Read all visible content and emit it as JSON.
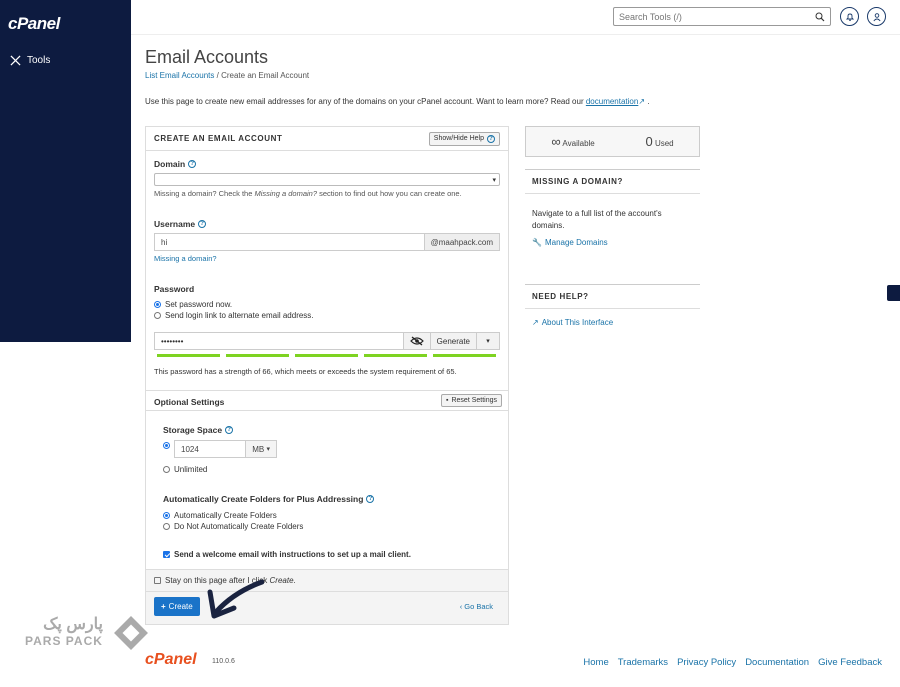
{
  "sidebar": {
    "logo": "cPanel",
    "items": [
      {
        "label": "Tools",
        "icon": "tools-icon"
      }
    ]
  },
  "topbar": {
    "search_placeholder": "Search Tools (/)"
  },
  "page": {
    "title": "Email Accounts",
    "breadcrumb": {
      "link": "List Email Accounts",
      "sep": "/",
      "current": "Create an Email Account"
    },
    "intro": "Use this page to create new email addresses for any of the domains on your cPanel account. Want to learn more? Read our",
    "intro_link": "documentation",
    "intro_end": "."
  },
  "form": {
    "title": "CREATE AN EMAIL ACCOUNT",
    "toggle_help": "Show/Hide Help",
    "domain": {
      "label": "Domain",
      "hint_pre": "Missing a domain? Check the ",
      "hint_em": "Missing a domain?",
      "hint_post": " section to find out how you can create one."
    },
    "username": {
      "label": "Username",
      "value": "hi",
      "suffix": "@maahpack.com",
      "missing_link": "Missing a domain?"
    },
    "password": {
      "label": "Password",
      "options": [
        "Set password now.",
        "Send login link to alternate email address."
      ],
      "value": "••••••••",
      "generate": "Generate",
      "strength_percent": 66,
      "strength_text": "This password has a strength of 66, which meets or exceeds the system requirement of 65."
    },
    "optional": {
      "title": "Optional Settings",
      "reset": "Reset Settings",
      "storage_label": "Storage Space",
      "storage_value": "1024",
      "storage_unit": "MB",
      "unlimited": "Unlimited",
      "folders_label": "Automatically Create Folders for Plus Addressing",
      "folders_options": [
        "Automatically Create Folders",
        "Do Not Automatically Create Folders"
      ],
      "welcome": "Send a welcome email with instructions to set up a mail client."
    },
    "stay": {
      "pre": "Stay on this page after I click ",
      "em": "Create",
      "post": "."
    },
    "create": "Create",
    "back": "Go Back"
  },
  "stats": {
    "available_symbol": "∞",
    "available_label": "Available",
    "used_value": "0",
    "used_label": "Used"
  },
  "missing_domain": {
    "title": "MISSING A DOMAIN?",
    "text": "Navigate to a full list of the account's domains.",
    "link": "Manage Domains"
  },
  "need_help": {
    "title": "NEED HELP?",
    "link": "About This Interface"
  },
  "footer": {
    "logo": "cPanel",
    "version": "110.0.6",
    "links": [
      "Home",
      "Trademarks",
      "Privacy Policy",
      "Documentation",
      "Give Feedback"
    ]
  },
  "watermark": {
    "line1": "پارس پک",
    "line2": "PARS PACK"
  }
}
